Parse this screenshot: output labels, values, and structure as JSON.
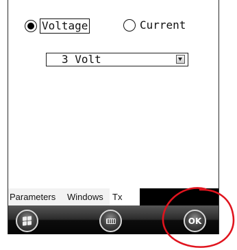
{
  "form": {
    "mode_options": [
      {
        "label": "Voltage",
        "selected": true
      },
      {
        "label": "Current",
        "selected": false
      }
    ],
    "range_select": {
      "value": "3 Volt"
    }
  },
  "tabs": [
    {
      "label": "Parameters"
    },
    {
      "label": "Windows"
    },
    {
      "label": "Tx",
      "active": true
    }
  ],
  "softkeys": {
    "start_icon": "windows-logo-icon",
    "keyboard_icon": "keyboard-icon",
    "ok_label": "OK"
  },
  "colors": {
    "softbar_dark": "#0c0c0c",
    "tab_background": "#f2f2f2",
    "annotation_red": "#e0141e"
  }
}
